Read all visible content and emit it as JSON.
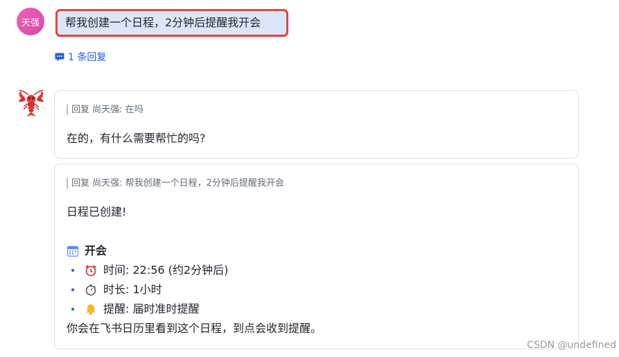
{
  "user": {
    "avatar_text": "天强",
    "message": "帮我创建一个日程，2分钟后提醒我开会",
    "reply_count_label": "1 条回复"
  },
  "bot": {
    "avatar_icon": "lobster-icon",
    "reply1": {
      "quote": "回复 尚天强: 在吗",
      "text": "在的，有什么需要帮忙的吗?"
    },
    "reply2": {
      "quote": "回复 尚天强: 帮我创建一个日程，2分钟后提醒我开会",
      "intro": "日程已创建!",
      "event_icon": "calendar-icon",
      "event_title": "开会",
      "items": [
        {
          "icon": "alarm-clock-icon",
          "text": "时间: 22:56 (约2分钟后)"
        },
        {
          "icon": "stopwatch-icon",
          "text": "时长: 1小时"
        },
        {
          "icon": "bell-icon",
          "text": "提醒: 届时准时提醒"
        }
      ],
      "footer": "你会在飞书日历里看到这个日程，到点会收到提醒。"
    }
  },
  "watermark": "CSDN @undefined",
  "colors": {
    "accent_blue": "#245bdb",
    "user_bubble_bg": "#dbe6fb",
    "highlight_border": "#e8433b",
    "avatar_pink": "#e257b0"
  }
}
